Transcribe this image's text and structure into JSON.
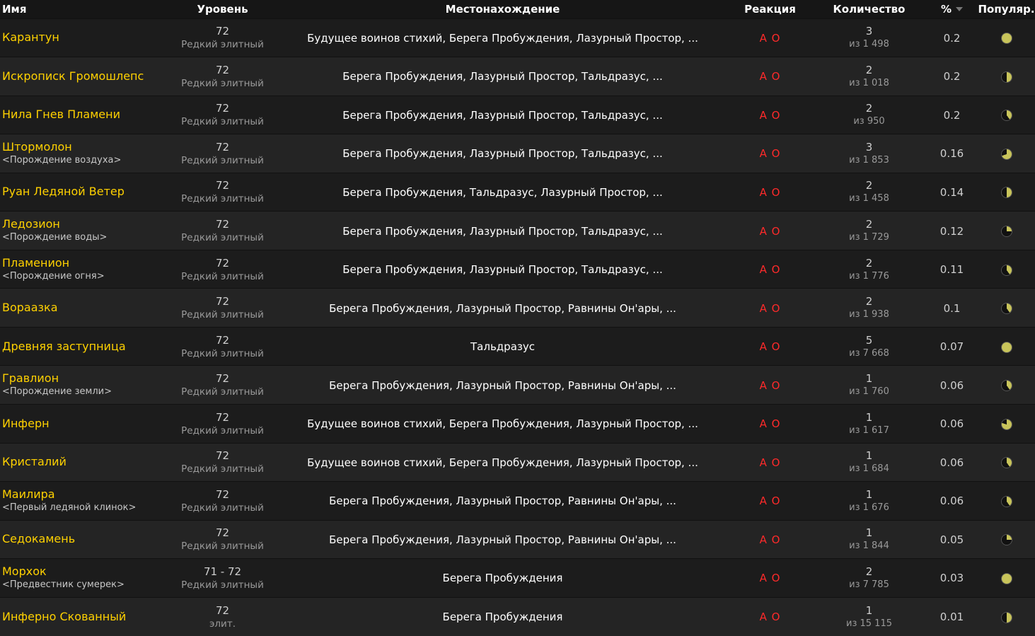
{
  "columns": {
    "name": "Имя",
    "level": "Уровень",
    "location": "Местонахождение",
    "reaction": "Реакция",
    "count": "Количество",
    "percent": "%",
    "popularity": "Популяр."
  },
  "colors": {
    "link": "#ffd100",
    "hostile": "#ff2a2a",
    "pie_light": "#c8c45a",
    "pie_dark": "#111111"
  },
  "rows": [
    {
      "name": "Карантун",
      "tag": "",
      "level": "72",
      "class": "Редкий элитный",
      "location": "Будущее воинов стихий, Берега Пробуждения, Лазурный Простор, ...",
      "react_a": "A",
      "react_o": "O",
      "count": "3",
      "of": "из 1 498",
      "percent": "0.2",
      "popularity": 1.0
    },
    {
      "name": "Искрописк Громошлепс",
      "tag": "",
      "level": "72",
      "class": "Редкий элитный",
      "location": "Берега Пробуждения, Лазурный Простор, Тальдразус, ...",
      "react_a": "A",
      "react_o": "O",
      "count": "2",
      "of": "из 1 018",
      "percent": "0.2",
      "popularity": 0.5
    },
    {
      "name": "Нила Гнев Пламени",
      "tag": "",
      "level": "72",
      "class": "Редкий элитный",
      "location": "Берега Пробуждения, Лазурный Простор, Тальдразус, ...",
      "react_a": "A",
      "react_o": "O",
      "count": "2",
      "of": "из 950",
      "percent": "0.2",
      "popularity": 0.4
    },
    {
      "name": "Штормолон",
      "tag": "<Порождение воздуха>",
      "level": "72",
      "class": "Редкий элитный",
      "location": "Берега Пробуждения, Лазурный Простор, Тальдразус, ...",
      "react_a": "A",
      "react_o": "O",
      "count": "3",
      "of": "из 1 853",
      "percent": "0.16",
      "popularity": 0.7
    },
    {
      "name": "Руан Ледяной Ветер",
      "tag": "",
      "level": "72",
      "class": "Редкий элитный",
      "location": "Берега Пробуждения, Тальдразус, Лазурный Простор, ...",
      "react_a": "A",
      "react_o": "O",
      "count": "2",
      "of": "из 1 458",
      "percent": "0.14",
      "popularity": 0.5
    },
    {
      "name": "Ледозион",
      "tag": "<Порождение воды>",
      "level": "72",
      "class": "Редкий элитный",
      "location": "Берега Пробуждения, Лазурный Простор, Тальдразус, ...",
      "react_a": "A",
      "react_o": "O",
      "count": "2",
      "of": "из 1 729",
      "percent": "0.12",
      "popularity": 0.25
    },
    {
      "name": "Пламенион",
      "tag": "<Порождение огня>",
      "level": "72",
      "class": "Редкий элитный",
      "location": "Берега Пробуждения, Лазурный Простор, Тальдразус, ...",
      "react_a": "A",
      "react_o": "O",
      "count": "2",
      "of": "из 1 776",
      "percent": "0.11",
      "popularity": 0.4
    },
    {
      "name": "Вораазка",
      "tag": "",
      "level": "72",
      "class": "Редкий элитный",
      "location": "Берега Пробуждения, Лазурный Простор, Равнины Он'ары, ...",
      "react_a": "A",
      "react_o": "O",
      "count": "2",
      "of": "из 1 938",
      "percent": "0.1",
      "popularity": 0.4
    },
    {
      "name": "Древняя заступница",
      "tag": "",
      "level": "72",
      "class": "Редкий элитный",
      "location": "Тальдразус",
      "react_a": "A",
      "react_o": "O",
      "count": "5",
      "of": "из 7 668",
      "percent": "0.07",
      "popularity": 1.0
    },
    {
      "name": "Гравлион",
      "tag": "<Порождение земли>",
      "level": "72",
      "class": "Редкий элитный",
      "location": "Берега Пробуждения, Лазурный Простор, Равнины Он'ары, ...",
      "react_a": "A",
      "react_o": "O",
      "count": "1",
      "of": "из 1 760",
      "percent": "0.06",
      "popularity": 0.4
    },
    {
      "name": "Инферн",
      "tag": "",
      "level": "72",
      "class": "Редкий элитный",
      "location": "Будущее воинов стихий, Берега Пробуждения, Лазурный Простор, ...",
      "react_a": "A",
      "react_o": "O",
      "count": "1",
      "of": "из 1 617",
      "percent": "0.06",
      "popularity": 0.8
    },
    {
      "name": "Кристалий",
      "tag": "",
      "level": "72",
      "class": "Редкий элитный",
      "location": "Будущее воинов стихий, Берега Пробуждения, Лазурный Простор, ...",
      "react_a": "A",
      "react_o": "O",
      "count": "1",
      "of": "из 1 684",
      "percent": "0.06",
      "popularity": 0.4
    },
    {
      "name": "Маилира",
      "tag": "<Первый ледяной клинок>",
      "level": "72",
      "class": "Редкий элитный",
      "location": "Берега Пробуждения, Лазурный Простор, Равнины Он'ары, ...",
      "react_a": "A",
      "react_o": "O",
      "count": "1",
      "of": "из 1 676",
      "percent": "0.06",
      "popularity": 0.4
    },
    {
      "name": "Седокамень",
      "tag": "",
      "level": "72",
      "class": "Редкий элитный",
      "location": "Берега Пробуждения, Лазурный Простор, Равнины Он'ары, ...",
      "react_a": "A",
      "react_o": "O",
      "count": "1",
      "of": "из 1 844",
      "percent": "0.05",
      "popularity": 0.25
    },
    {
      "name": "Морхок",
      "tag": "<Предвестник сумерек>",
      "level": "71 - 72",
      "class": "Редкий элитный",
      "location": "Берега Пробуждения",
      "react_a": "A",
      "react_o": "O",
      "count": "2",
      "of": "из 7 785",
      "percent": "0.03",
      "popularity": 1.0
    },
    {
      "name": "Инферно Скованный",
      "tag": "",
      "level": "72",
      "class": "элит.",
      "location": "Берега Пробуждения",
      "react_a": "A",
      "react_o": "O",
      "count": "1",
      "of": "из 15 115",
      "percent": "0.01",
      "popularity": 0.5
    }
  ]
}
